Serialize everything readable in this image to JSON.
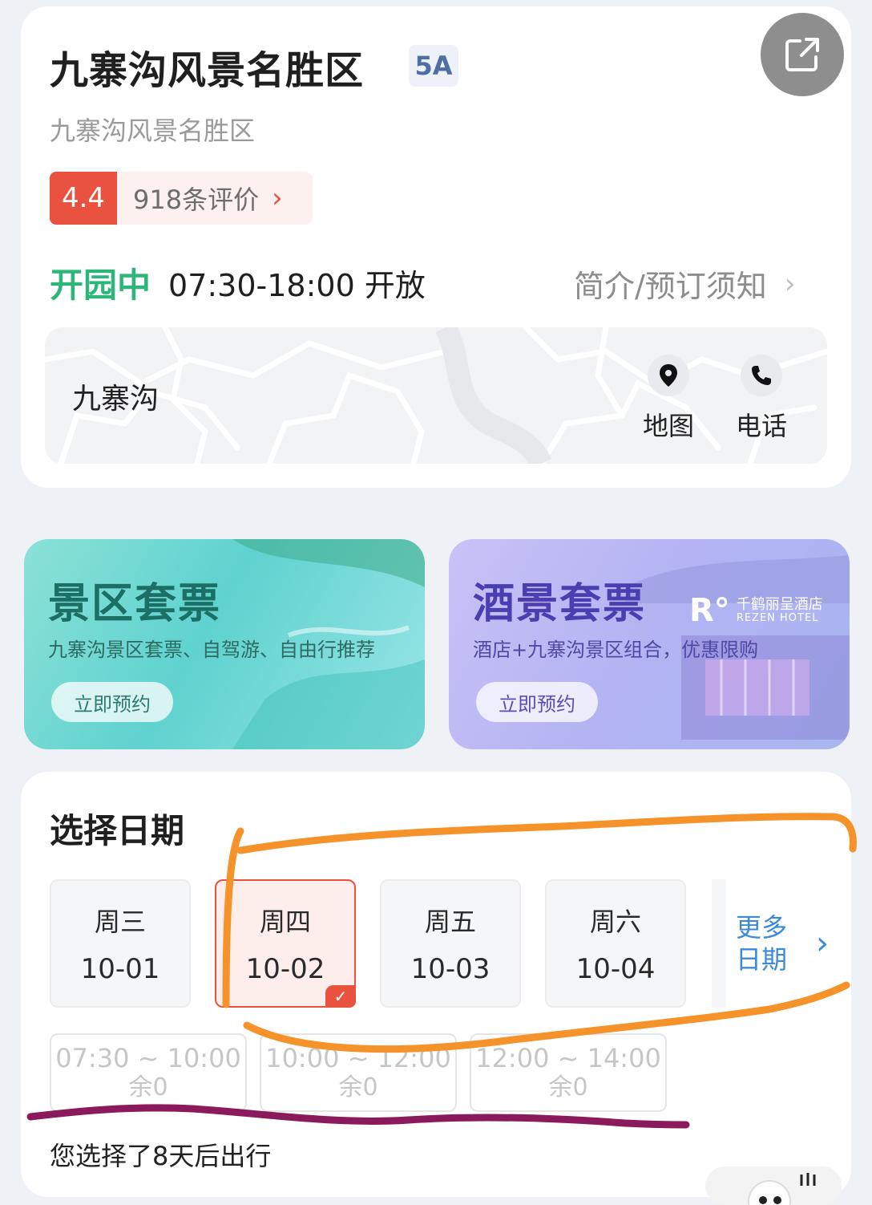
{
  "attraction": {
    "name": "九寨沟风景名胜区",
    "level": "5A",
    "subtitle": "九寨沟风景名胜区",
    "rating": "4.4",
    "reviews": "918条评价",
    "status": "开园中",
    "hours": "07:30-18:00 开放",
    "intro_link": "简介/预订须知"
  },
  "map": {
    "label": "九寨沟",
    "map_button": "地图",
    "phone_button": "电话"
  },
  "promos": [
    {
      "title": "景区套票",
      "desc": "九寨沟景区套票、自驾游、自由行推荐",
      "button": "立即预约"
    },
    {
      "title": "酒景套票",
      "desc": "酒店+九寨沟景区组合，优惠限购",
      "button": "立即预约",
      "logo_cn": "千鹤丽呈酒店",
      "logo_en": "REZEN HOTEL"
    }
  ],
  "date_section": {
    "title": "选择日期",
    "dates": [
      {
        "weekday": "周三",
        "date": "10-01",
        "selected": false
      },
      {
        "weekday": "周四",
        "date": "10-02",
        "selected": true
      },
      {
        "weekday": "周五",
        "date": "10-03",
        "selected": false
      },
      {
        "weekday": "周六",
        "date": "10-04",
        "selected": false
      }
    ],
    "more_dates": "更多日期",
    "time_slots": [
      {
        "time": "07:30 ~ 10:00",
        "remaining": "余0"
      },
      {
        "time": "10:00 ~ 12:00",
        "remaining": "余0"
      },
      {
        "time": "12:00 ~ 14:00",
        "remaining": "余0"
      }
    ],
    "trip_note": "您选择了8天后出行"
  },
  "colors": {
    "accent_red": "#e8523f",
    "open_green": "#2db57a",
    "link_blue": "#3a8ad9",
    "annotation_orange": "#f5922a",
    "annotation_purple": "#8b1a5c"
  }
}
